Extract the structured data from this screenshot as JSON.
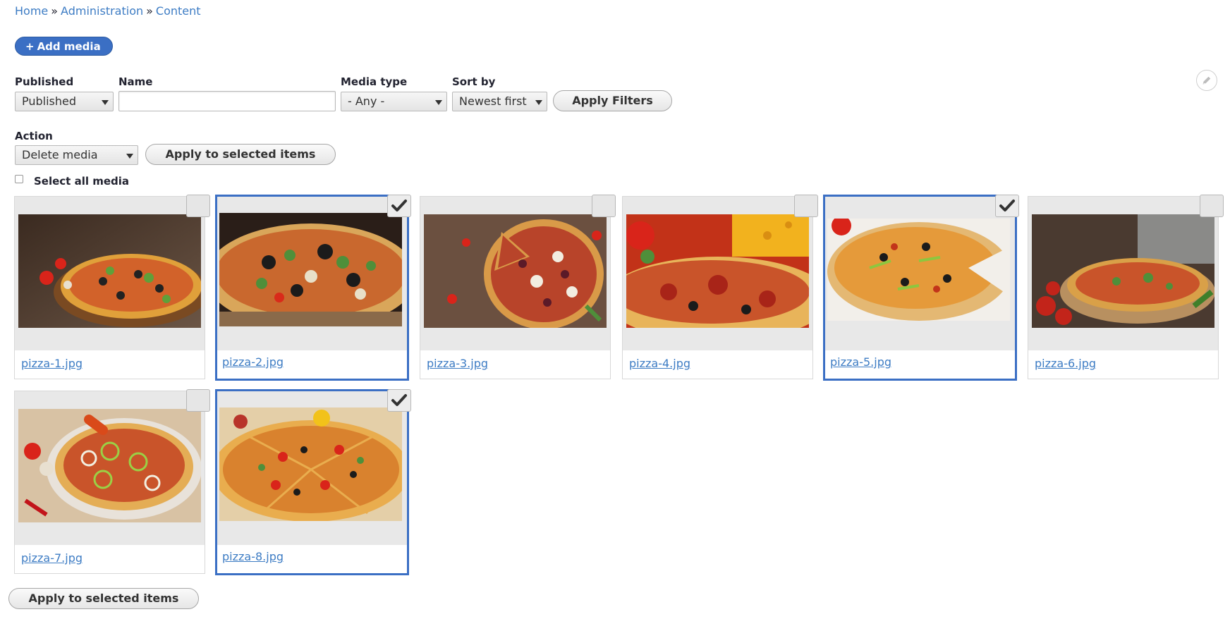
{
  "breadcrumb": [
    {
      "label": "Home"
    },
    {
      "label": "Administration"
    },
    {
      "label": "Content"
    }
  ],
  "breadcrumb_sep": "»",
  "add_media": {
    "plus": "+",
    "label": "Add media"
  },
  "filters": {
    "published_label": "Published",
    "published_value": "Published",
    "name_label": "Name",
    "name_value": "",
    "media_type_label": "Media type",
    "media_type_value": "- Any -",
    "sort_label": "Sort by",
    "sort_value": "Newest first",
    "apply_filters": "Apply Filters"
  },
  "action": {
    "label": "Action",
    "value": "Delete media",
    "apply_top": "Apply to selected items",
    "apply_bottom": "Apply to selected items"
  },
  "select_all_label": "Select all media",
  "media": [
    {
      "name": "pizza-1.jpg",
      "selected": false
    },
    {
      "name": "pizza-2.jpg",
      "selected": true
    },
    {
      "name": "pizza-3.jpg",
      "selected": false
    },
    {
      "name": "pizza-4.jpg",
      "selected": false
    },
    {
      "name": "pizza-5.jpg",
      "selected": true
    },
    {
      "name": "pizza-6.jpg",
      "selected": false
    },
    {
      "name": "pizza-7.jpg",
      "selected": false
    },
    {
      "name": "pizza-8.jpg",
      "selected": true
    }
  ],
  "colors": {
    "accent": "#3b6fc4",
    "link": "#3d7cc4"
  }
}
